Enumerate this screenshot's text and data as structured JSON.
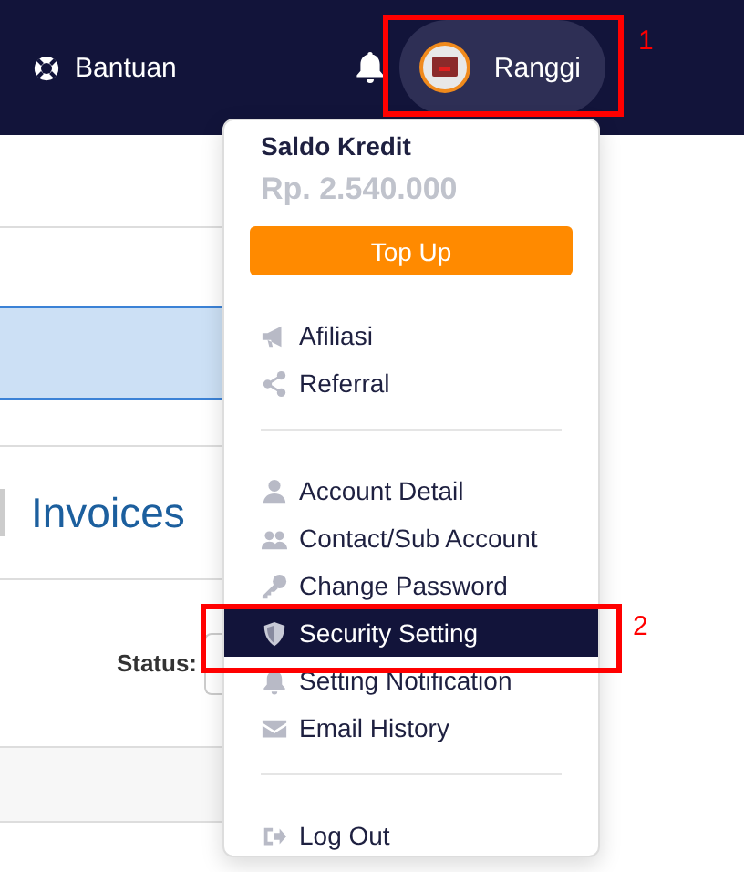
{
  "header": {
    "help_label": "Bantuan",
    "user_name": "Ranggi"
  },
  "page": {
    "title": "Invoices",
    "status_label": "Status:"
  },
  "dropdown": {
    "balance_label": "Saldo Kredit",
    "balance": "Rp. 2.540.000",
    "topup_button": "Top Up",
    "sections": [
      {
        "items": [
          {
            "label": "Afiliasi",
            "kind": "megaphone",
            "selected": false
          },
          {
            "label": "Referral",
            "kind": "share",
            "selected": false
          }
        ]
      },
      {
        "items": [
          {
            "label": "Account Detail",
            "kind": "user",
            "selected": false
          },
          {
            "label": "Contact/Sub Account",
            "kind": "users",
            "selected": false
          },
          {
            "label": "Change Password",
            "kind": "key",
            "selected": false
          },
          {
            "label": "Security Setting",
            "kind": "shield",
            "selected": true
          },
          {
            "label": "Setting Notification",
            "kind": "bell",
            "selected": false
          },
          {
            "label": "Email History",
            "kind": "envelope",
            "selected": false
          }
        ]
      },
      {
        "items": [
          {
            "label": "Log Out",
            "kind": "logout",
            "selected": false
          }
        ]
      }
    ]
  },
  "annotations": [
    {
      "label": "1",
      "kind": "user"
    },
    {
      "label": "2",
      "kind": "menu"
    }
  ]
}
